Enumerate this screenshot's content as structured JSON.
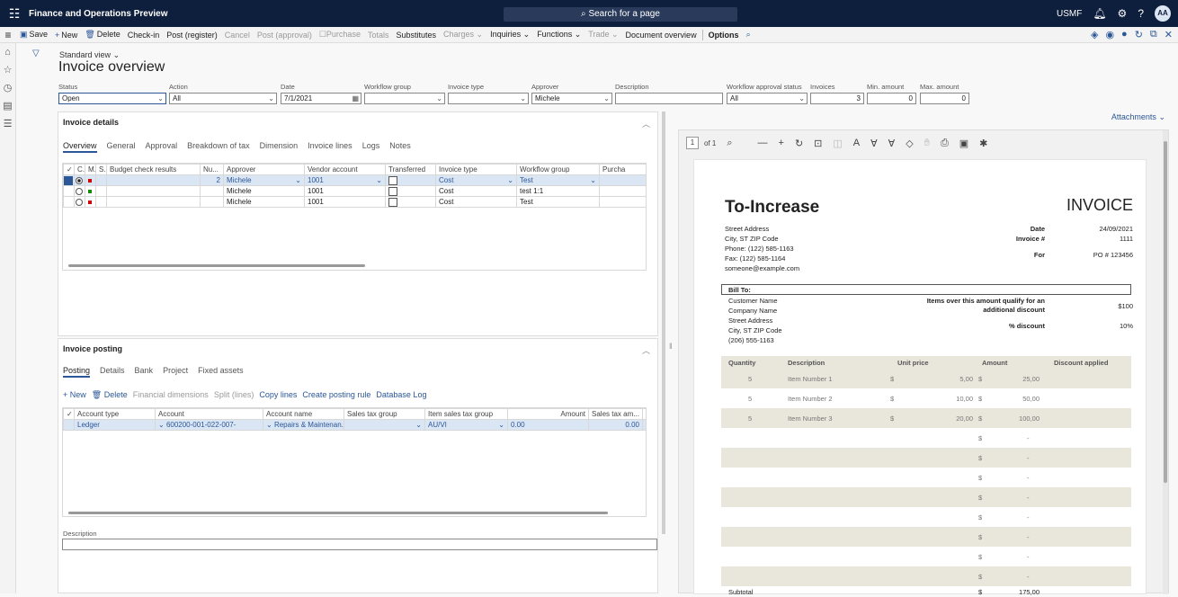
{
  "topbar": {
    "app_title": "Finance and Operations Preview",
    "search_placeholder": "Search for a page",
    "company": "USMF",
    "avatar_initials": "AA",
    "icons": [
      "bell-icon",
      "gear-icon",
      "help-icon"
    ]
  },
  "actions": {
    "save": "Save",
    "new": "New",
    "delete": "Delete",
    "checkin": "Check-in",
    "post_register": "Post (register)",
    "cancel": "Cancel",
    "post_approval": "Post (approval)",
    "purchase": "Purchase",
    "totals": "Totals",
    "substitutes": "Substitutes",
    "charges": "Charges",
    "inquiries": "Inquiries",
    "functions": "Functions",
    "trade": "Trade",
    "document_overview": "Document overview",
    "options": "Options"
  },
  "page": {
    "standard_view": "Standard view",
    "title": "Invoice overview"
  },
  "filters": {
    "status": {
      "label": "Status",
      "value": "Open"
    },
    "action": {
      "label": "Action",
      "value": "All"
    },
    "date": {
      "label": "Date",
      "value": "7/1/2021"
    },
    "workflow_group": {
      "label": "Workflow group",
      "value": ""
    },
    "invoice_type": {
      "label": "Invoice type",
      "value": ""
    },
    "approver": {
      "label": "Approver",
      "value": "Michele"
    },
    "description": {
      "label": "Description",
      "value": ""
    },
    "workflow_status": {
      "label": "Workflow approval status",
      "value": "All"
    },
    "invoices": {
      "label": "Invoices",
      "value": "3"
    },
    "min_amount": {
      "label": "Min. amount",
      "value": "0"
    },
    "max_amount": {
      "label": "Max. amount",
      "value": "0"
    }
  },
  "invoice_details": {
    "title": "Invoice details",
    "tabs": [
      "Overview",
      "General",
      "Approval",
      "Breakdown of tax",
      "Dimension",
      "Invoice lines",
      "Logs",
      "Notes"
    ],
    "columns": [
      "C...",
      "M...",
      "S...",
      "Budget check results",
      "Nu...",
      "Approver",
      "Vendor account",
      "Transferred",
      "Invoice type",
      "Workflow group",
      "Purcha"
    ],
    "rows": [
      {
        "number": "2",
        "approver": "Michele",
        "vendor": "1001",
        "invoice_type": "Cost",
        "workflow_group": "Test",
        "dot_color": "#d00000"
      },
      {
        "number": "",
        "approver": "Michele",
        "vendor": "1001",
        "invoice_type": "Cost",
        "workflow_group": "test 1:1",
        "dot_color": "#108a00"
      },
      {
        "number": "",
        "approver": "Michele",
        "vendor": "1001",
        "invoice_type": "Cost",
        "workflow_group": "Test",
        "dot_color": "#d00000"
      }
    ]
  },
  "invoice_posting": {
    "title": "Invoice posting",
    "tabs": [
      "Posting",
      "Details",
      "Bank",
      "Project",
      "Fixed assets"
    ],
    "actions": {
      "new": "New",
      "delete": "Delete",
      "financial_dimensions": "Financial dimensions",
      "split_lines": "Split (lines)",
      "copy_lines": "Copy lines",
      "create_posting_rule": "Create posting rule",
      "database_log": "Database Log"
    },
    "columns": [
      "Account type",
      "Account",
      "Account name",
      "Sales tax group",
      "Item sales tax group",
      "Amount",
      "Sales tax am...",
      "U:"
    ],
    "rows": [
      {
        "account_type": "Ledger",
        "account": "600200-001-022-007-",
        "account_name": "Repairs & Maintenan...",
        "sales_tax_group": "",
        "item_sales_tax_group": "AU/VI",
        "amount": "0.00",
        "sales_tax_amount": "0.00"
      }
    ],
    "description_label": "Description"
  },
  "attachments": "Attachments",
  "viewer": {
    "page": "1",
    "of_pages": "of 1"
  },
  "invoice_doc": {
    "company": "To-Increase",
    "title": "INVOICE",
    "address": [
      "Street Address",
      "City, ST  ZIP Code",
      "Phone: (122) 585-1163",
      "Fax: (122) 585-1164",
      "someone@example.com"
    ],
    "meta_labels": [
      "Date",
      "Invoice #",
      "For"
    ],
    "meta_values": [
      "24/09/2021",
      "1111",
      "PO # 123456"
    ],
    "bill_to_label": "Bill To:",
    "bill_to": [
      "Customer Name",
      "Company Name",
      "Street Address",
      "City, ST  ZIP Code",
      "(206) 555-1163"
    ],
    "discount_text_1": "Items over this amount qualify for an",
    "discount_text_2": "additional discount",
    "discount_threshold": "$100",
    "pct_discount_label": "% discount",
    "pct_discount": "10%",
    "headers": [
      "Quantity",
      "Description",
      "Unit price",
      "Amount",
      "Discount applied"
    ],
    "items": [
      {
        "qty": "5",
        "desc": "Item Number 1",
        "cur": "$",
        "price": "5,00",
        "cur2": "$",
        "amount": "25,00"
      },
      {
        "qty": "5",
        "desc": "Item Number 2",
        "cur": "$",
        "price": "10,00",
        "cur2": "$",
        "amount": "50,00"
      },
      {
        "qty": "5",
        "desc": "Item Number 3",
        "cur": "$",
        "price": "20,00",
        "cur2": "$",
        "amount": "100,00"
      }
    ],
    "empty_currency": "$",
    "empty_amount": "-",
    "subtotal_label": "Subtotal",
    "subtotal_currency": "$",
    "subtotal": "175,00"
  }
}
